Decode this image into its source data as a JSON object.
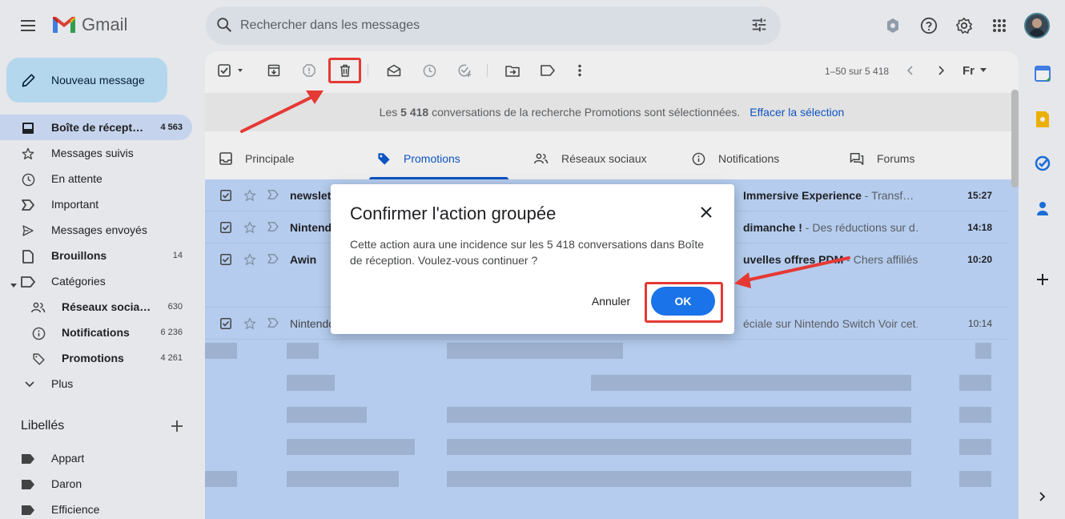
{
  "header": {
    "app_name": "Gmail",
    "search_placeholder": "Rechercher dans les messages",
    "icons": [
      "menu-icon",
      "search-icon",
      "tune-icon",
      "shield-icon",
      "help-icon",
      "gear-icon",
      "apps-icon",
      "avatar"
    ]
  },
  "sidebar": {
    "compose_label": "Nouveau message",
    "items": [
      {
        "label": "Boîte de récept…",
        "count": "4 563",
        "icon": "inbox-icon"
      },
      {
        "label": "Messages suivis",
        "count": "",
        "icon": "star-icon"
      },
      {
        "label": "En attente",
        "count": "",
        "icon": "clock-icon"
      },
      {
        "label": "Important",
        "count": "",
        "icon": "important-icon"
      },
      {
        "label": "Messages envoyés",
        "count": "",
        "icon": "send-icon"
      },
      {
        "label": "Brouillons",
        "count": "14",
        "icon": "draft-icon"
      },
      {
        "label": "Catégories",
        "count": "",
        "icon": "label-icon"
      },
      {
        "label": "Réseaux socia…",
        "count": "630",
        "icon": "people-icon"
      },
      {
        "label": "Notifications",
        "count": "6 236",
        "icon": "info-icon"
      },
      {
        "label": "Promotions",
        "count": "4 261",
        "icon": "tag-icon"
      },
      {
        "label": "Plus",
        "count": "",
        "icon": "chevron-down-icon"
      }
    ],
    "labels_heading": "Libellés",
    "labels": [
      {
        "label": "Appart"
      },
      {
        "label": "Daron"
      },
      {
        "label": "Efficience"
      }
    ]
  },
  "toolbar": {
    "pager_text": "1–50 sur 5 418",
    "lang_label": "Fr"
  },
  "banner": {
    "text_before": "Les",
    "count": "5 418",
    "text_after": "conversations de la recherche Promotions sont sélectionnées.",
    "clear_link": "Effacer la sélection"
  },
  "tabs": [
    {
      "label": "Principale",
      "icon": "inbox-icon"
    },
    {
      "label": "Promotions",
      "icon": "tag-icon"
    },
    {
      "label": "Réseaux sociaux",
      "icon": "people-icon"
    },
    {
      "label": "Notifications",
      "icon": "info-icon"
    },
    {
      "label": "Forums",
      "icon": "forum-icon"
    }
  ],
  "emails": [
    {
      "sender": "newslet",
      "subject": "Immersive Experience",
      "snippet": " - Transf…",
      "time": "15:27",
      "read": false
    },
    {
      "sender": "Nintendo",
      "subject": "dimanche !",
      "snippet": " - Des réductions sur d…",
      "time": "14:18",
      "read": false
    },
    {
      "sender": "Awin",
      "subject": "uvelles offres PDM",
      "snippet": " - Chers affiliés…",
      "time": "10:20",
      "read": false
    },
    {
      "sender": "Nintendo",
      "subject": "",
      "snippet": "éciale sur Nintendo Switch Voir cet…",
      "time": "10:14",
      "read": true
    }
  ],
  "dialog": {
    "title": "Confirmer l'action groupée",
    "message": "Cette action aura une incidence sur les 5 418 conversations dans Boîte de réception. Voulez-vous continuer ?",
    "cancel_label": "Annuler",
    "ok_label": "OK"
  },
  "colors": {
    "accent": "#0b57d0",
    "selected_row": "#c2dbff",
    "compose": "#c2e7ff",
    "annotation": "#e53935"
  }
}
